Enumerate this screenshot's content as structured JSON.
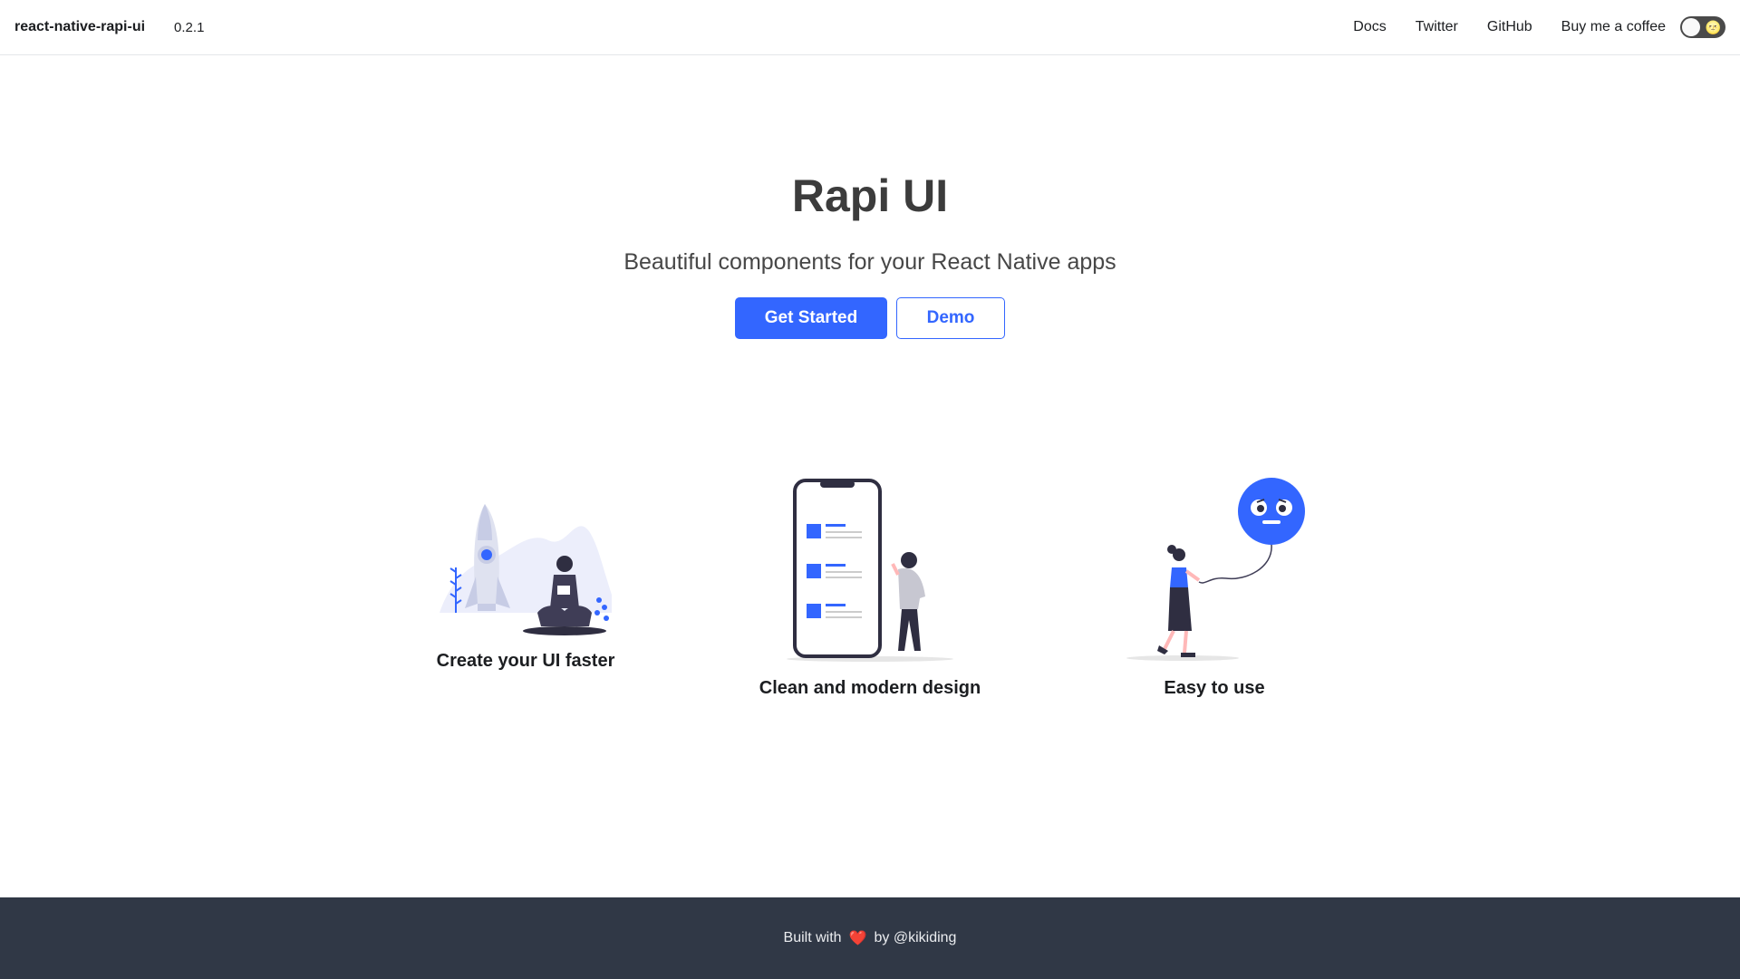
{
  "nav": {
    "brand": "react-native-rapi-ui",
    "version": "0.2.1",
    "links": [
      "Docs",
      "Twitter",
      "GitHub",
      "Buy me a coffee"
    ],
    "theme_toggle_emoji": "🌝"
  },
  "hero": {
    "title": "Rapi UI",
    "subtitle": "Beautiful components for your React Native apps",
    "primary_button": "Get Started",
    "secondary_button": "Demo"
  },
  "features": [
    {
      "title": "Create your UI faster",
      "icon": "rocket-illustration-icon"
    },
    {
      "title": "Clean and modern design",
      "icon": "phone-illustration-icon"
    },
    {
      "title": "Easy to use",
      "icon": "balloon-illustration-icon"
    }
  ],
  "footer": {
    "prefix": "Built with",
    "heart": "❤️",
    "suffix": "by @kikiding"
  },
  "colors": {
    "accent": "#3366ff",
    "footer_bg": "#303846",
    "title": "#3c3c3c"
  }
}
